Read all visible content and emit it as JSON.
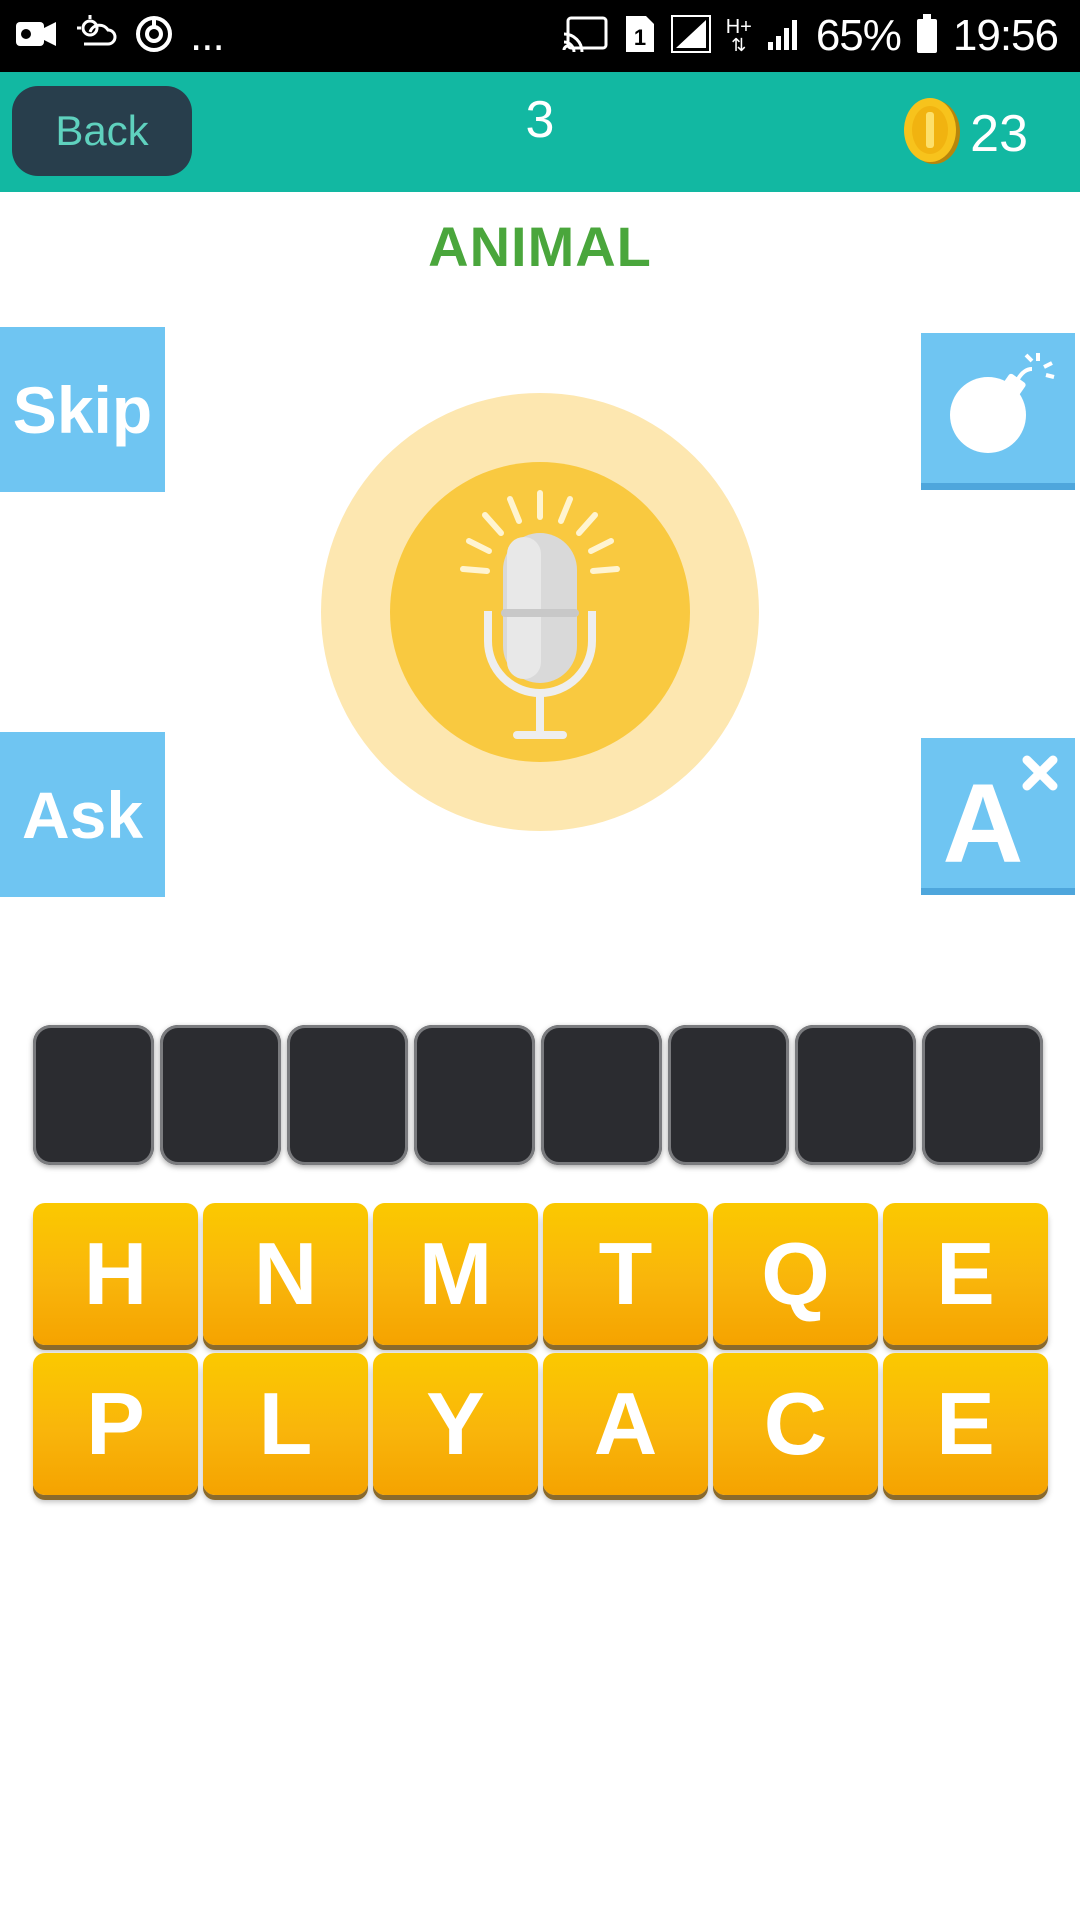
{
  "status_bar": {
    "battery_percent": "65%",
    "time": "19:56",
    "sim_slot": "1",
    "network": "H+",
    "overflow": "..."
  },
  "header": {
    "back_label": "Back",
    "level": "3",
    "coins": "23"
  },
  "category": "ANIMAL",
  "side_buttons": {
    "skip_label": "Skip",
    "ask_label": "Ask",
    "bomb_icon": "bomb-icon",
    "remove_letter_icon": "remove-letter-icon"
  },
  "answer": {
    "slots": [
      "",
      "",
      "",
      "",
      "",
      "",
      "",
      ""
    ]
  },
  "letters": [
    "H",
    "N",
    "M",
    "T",
    "Q",
    "E",
    "P",
    "L",
    "Y",
    "A",
    "C",
    "E"
  ],
  "colors": {
    "header": "#12b8a2",
    "category": "#4aa63c",
    "side_button": "#6fc5f2",
    "tile": "#f9b50b",
    "slot": "#2b2c30"
  }
}
